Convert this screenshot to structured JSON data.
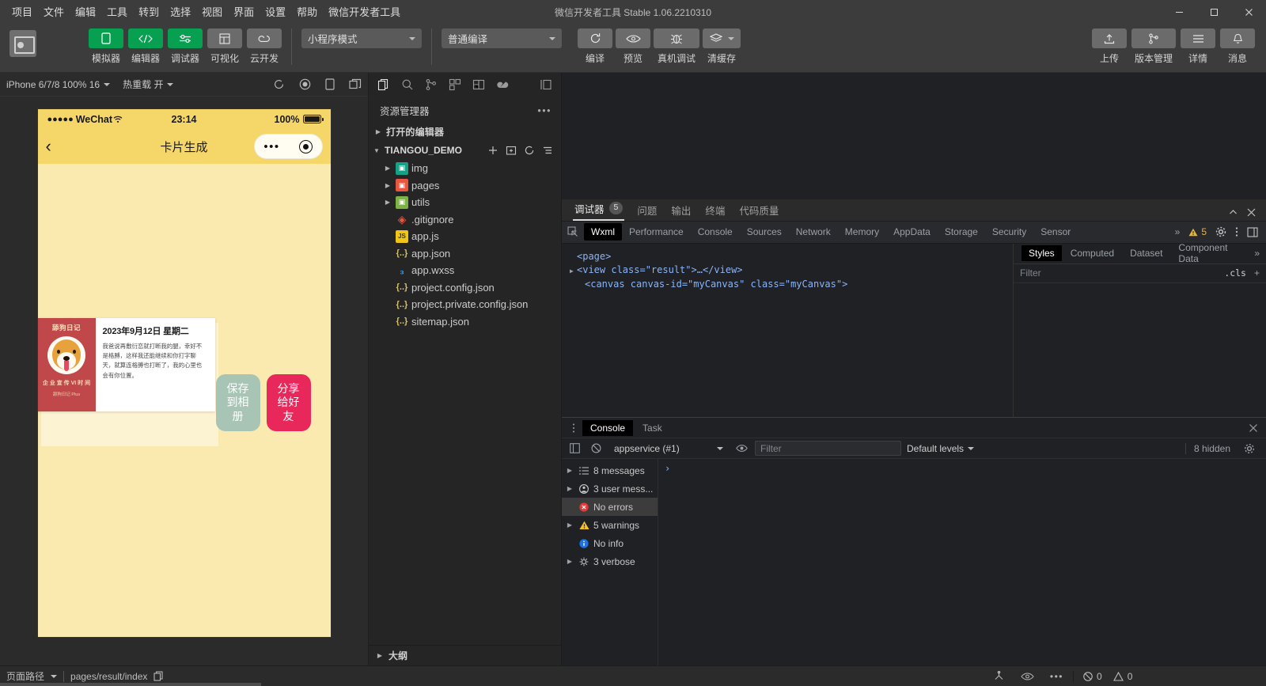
{
  "window": {
    "title": "微信开发者工具 Stable 1.06.2210310",
    "controls": [
      "minimize",
      "maximize",
      "close"
    ]
  },
  "menu": {
    "items": [
      "项目",
      "文件",
      "编辑",
      "工具",
      "转到",
      "选择",
      "视图",
      "界面",
      "设置",
      "帮助",
      "微信开发者工具"
    ]
  },
  "toolbar": {
    "left_buttons": [
      {
        "label": "模拟器",
        "icon": "phone-icon",
        "active": true
      },
      {
        "label": "编辑器",
        "icon": "code-icon",
        "active": true
      },
      {
        "label": "调试器",
        "icon": "debug-icon",
        "active": true
      },
      {
        "label": "可视化",
        "icon": "layout-icon",
        "active": false
      },
      {
        "label": "云开发",
        "icon": "cloud-icon",
        "active": false
      }
    ],
    "mode_select": "小程序模式",
    "compile_select": "普通编译",
    "mid_buttons": [
      {
        "label": "编译",
        "icon": "refresh-icon"
      },
      {
        "label": "预览",
        "icon": "eye-icon"
      },
      {
        "label": "真机调试",
        "icon": "bug-icon"
      },
      {
        "label": "清缓存",
        "icon": "layers-icon"
      }
    ],
    "right_buttons": [
      {
        "label": "上传",
        "icon": "upload-icon"
      },
      {
        "label": "版本管理",
        "icon": "branch-icon"
      },
      {
        "label": "详情",
        "icon": "menu-icon"
      },
      {
        "label": "消息",
        "icon": "bell-icon"
      }
    ]
  },
  "simulator": {
    "device": "iPhone 6/7/8 100% 16",
    "hot_reload": "热重载 开",
    "icons": [
      "refresh-icon",
      "record-icon",
      "rotate-icon",
      "multiscreen-icon"
    ],
    "phone": {
      "status": {
        "dots": "●●●●●",
        "carrier": "WeChat",
        "wifi": "wifi-icon",
        "time": "23:14",
        "battery": "100%"
      },
      "navbar": {
        "back": "back-icon",
        "title": "卡片生成",
        "capsule_dots": "•••",
        "capsule_target": "target-icon"
      },
      "card": {
        "brand": "舔狗日记",
        "brand_sub": "企 业 宣 传 VI 时 间",
        "brand_foot": "舔狗日记 Plus",
        "date": "2023年9月12日 星期二",
        "body": "我爸说再敷衍恋就打断我的腿，幸好不是格膊，这样我还能继续和你打字聊天，就算连格膊也打断了，我的心里也会有你位置。"
      },
      "buttons": [
        {
          "label": "保存到相册",
          "color": "#a7c4b5"
        },
        {
          "label": "分享给好友",
          "color": "#e8275a"
        }
      ]
    }
  },
  "explorer": {
    "activity_icons": [
      "files-icon",
      "search-icon",
      "source-control-icon",
      "extensions-icon",
      "debug-console-icon",
      "cloud-icon",
      "collapse-icon"
    ],
    "title": "资源管理器",
    "more": "•••",
    "open_editors": "打开的编辑器",
    "project": "TIANGOU_DEMO",
    "project_actions": [
      "new-file-icon",
      "new-folder-icon",
      "refresh-icon",
      "collapse-all-icon"
    ],
    "tree": [
      {
        "name": "img",
        "type": "folder",
        "icon": "folder-img"
      },
      {
        "name": "pages",
        "type": "folder",
        "icon": "folder-pages"
      },
      {
        "name": "utils",
        "type": "folder",
        "icon": "folder-utils"
      },
      {
        "name": ".gitignore",
        "type": "file",
        "icon": "git-icon"
      },
      {
        "name": "app.js",
        "type": "file",
        "icon": "js-icon"
      },
      {
        "name": "app.json",
        "type": "file",
        "icon": "json-icon"
      },
      {
        "name": "app.wxss",
        "type": "file",
        "icon": "css-icon"
      },
      {
        "name": "project.config.json",
        "type": "file",
        "icon": "json-icon"
      },
      {
        "name": "project.private.config.json",
        "type": "file",
        "icon": "json-icon"
      },
      {
        "name": "sitemap.json",
        "type": "file",
        "icon": "json-icon"
      }
    ],
    "outline": "大纲"
  },
  "debugger": {
    "tabs": [
      {
        "label": "调试器",
        "badge": "5",
        "active": true
      },
      {
        "label": "问题",
        "badge": "",
        "active": false
      },
      {
        "label": "输出",
        "badge": "",
        "active": false
      },
      {
        "label": "终端",
        "badge": "",
        "active": false
      },
      {
        "label": "代码质量",
        "badge": "",
        "active": false
      }
    ],
    "panel_controls": [
      "collapse-icon",
      "close-icon"
    ],
    "devtools_tabs": [
      "Wxml",
      "Performance",
      "Console",
      "Sources",
      "Network",
      "Memory",
      "AppData",
      "Storage",
      "Security",
      "Sensor"
    ],
    "devtools_active": "Wxml",
    "overflow": "»",
    "warning_count": "5",
    "dom": [
      {
        "indent": 0,
        "twisty": false,
        "text": "<page>",
        "kind": "tag"
      },
      {
        "indent": 0,
        "twisty": true,
        "text": "<view class=\"result\">…</view>",
        "kind": "mixed"
      },
      {
        "indent": 1,
        "twisty": false,
        "text": "<canvas canvas-id=\"myCanvas\" class=\"myCanvas\">",
        "kind": "mixed"
      }
    ],
    "styles": {
      "tabs": [
        "Styles",
        "Computed",
        "Dataset",
        "Component Data"
      ],
      "active": "Styles",
      "more": "»",
      "filter_placeholder": "Filter",
      "cls_button": ".cls",
      "add_button": "+"
    }
  },
  "console": {
    "tabs": [
      "Console",
      "Task"
    ],
    "active": "Console",
    "context": "appservice (#1)",
    "filter_placeholder": "Filter",
    "levels": "Default levels",
    "hidden": "8 hidden",
    "sidebar": [
      {
        "label": "8 messages",
        "icon": "list-icon",
        "twisty": true,
        "selected": false
      },
      {
        "label": "3 user mess...",
        "icon": "user-icon",
        "twisty": true,
        "selected": false
      },
      {
        "label": "No errors",
        "icon": "error-icon",
        "twisty": false,
        "selected": true
      },
      {
        "label": "5 warnings",
        "icon": "warning-icon",
        "twisty": true,
        "selected": false
      },
      {
        "label": "No info",
        "icon": "info-icon",
        "twisty": false,
        "selected": false
      },
      {
        "label": "3 verbose",
        "icon": "verbose-icon",
        "twisty": true,
        "selected": false
      }
    ],
    "prompt": "›"
  },
  "statusbar": {
    "page_path_label": "页面路径",
    "page_path": "pages/result/index",
    "copy_icon": "copy-icon",
    "icons": [
      "tree-icon",
      "eye-icon",
      "more-icon"
    ],
    "errors": "0",
    "warnings": "0"
  },
  "colors": {
    "accent_green": "#07a050",
    "title_bg": "#3c3c3c",
    "panel_bg": "#252526",
    "devtools_bg": "#202124",
    "phone_bg": "#faeab0",
    "phone_header": "#f5d769",
    "card_red": "#c0484b",
    "share_pink": "#e8275a",
    "save_green": "#a7c4b5"
  }
}
